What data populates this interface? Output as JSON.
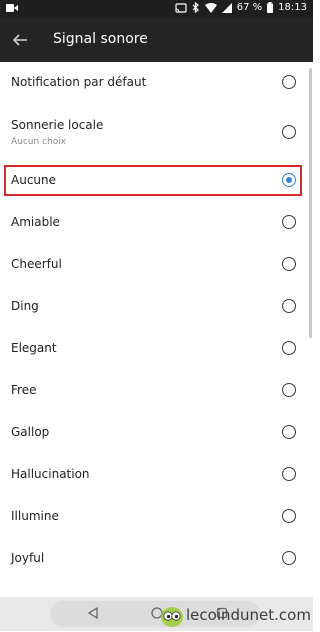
{
  "status_bar": {
    "battery_percent": "67 %",
    "time": "18:13",
    "icons": [
      "video-icon",
      "cast-icon",
      "bluetooth-icon",
      "wifi-icon",
      "signal-icon",
      "battery-icon"
    ]
  },
  "app_bar": {
    "title": "Signal sonore",
    "back_icon": "arrow-left-icon"
  },
  "options": [
    {
      "label": "Notification par défaut",
      "sublabel": null,
      "selected": false
    },
    {
      "label": "Sonnerie locale",
      "sublabel": "Aucun choix",
      "selected": false
    },
    {
      "label": "Aucune",
      "sublabel": null,
      "selected": true
    },
    {
      "label": "Amiable",
      "sublabel": null,
      "selected": false
    },
    {
      "label": "Cheerful",
      "sublabel": null,
      "selected": false
    },
    {
      "label": "Ding",
      "sublabel": null,
      "selected": false
    },
    {
      "label": "Elegant",
      "sublabel": null,
      "selected": false
    },
    {
      "label": "Free",
      "sublabel": null,
      "selected": false
    },
    {
      "label": "Gallop",
      "sublabel": null,
      "selected": false
    },
    {
      "label": "Hallucination",
      "sublabel": null,
      "selected": false
    },
    {
      "label": "Illumine",
      "sublabel": null,
      "selected": false
    },
    {
      "label": "Joyful",
      "sublabel": null,
      "selected": false
    }
  ],
  "colors": {
    "accent": "#2f86d1",
    "highlight_frame": "#d9272e",
    "app_bar": "#242424"
  },
  "nav_bar": {
    "icons": [
      "triangle-back-icon",
      "circle-home-icon",
      "square-recents-icon"
    ]
  },
  "watermark": {
    "text": "lecoindunet.com",
    "logo": "owl-eyes-logo"
  }
}
